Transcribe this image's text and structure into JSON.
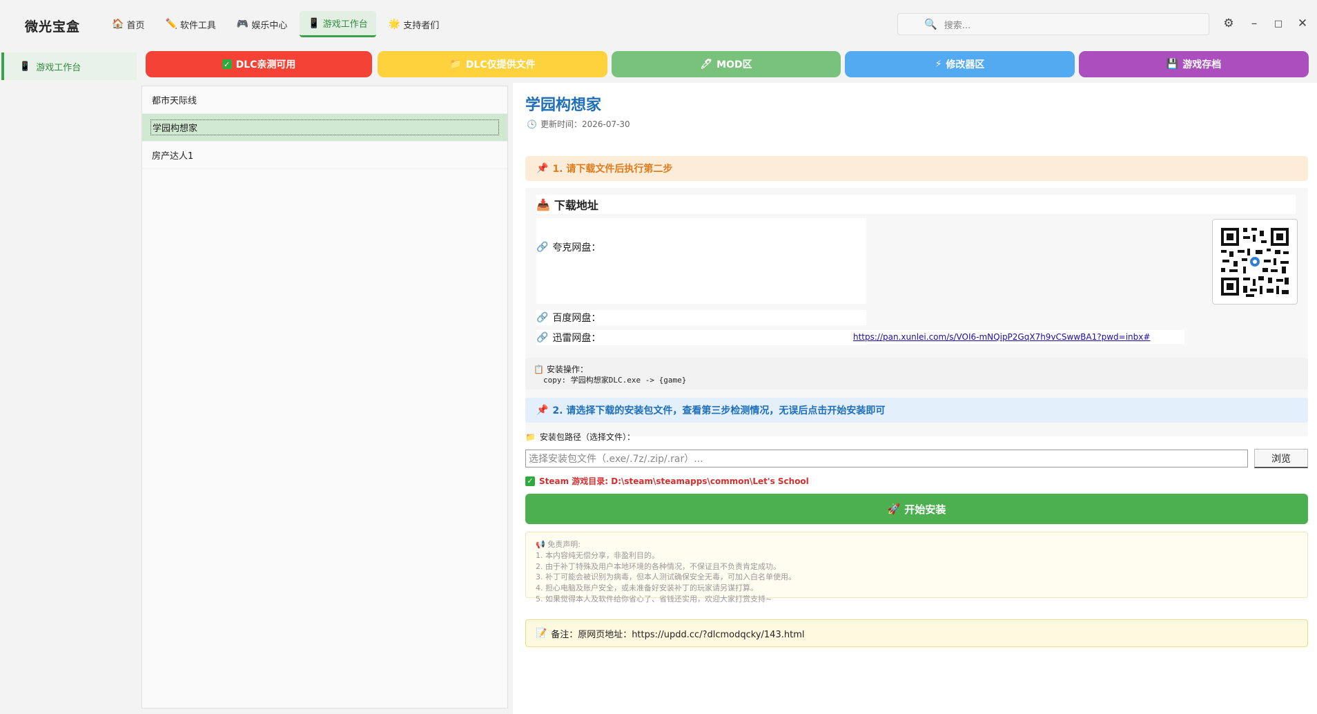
{
  "app": {
    "title": "微光宝盒"
  },
  "nav": {
    "items": [
      {
        "label": "首页",
        "icon": "home-icon"
      },
      {
        "label": "软件工具",
        "icon": "pencil-icon"
      },
      {
        "label": "娱乐中心",
        "icon": "gamepad-icon"
      },
      {
        "label": "游戏工作台",
        "icon": "phone-icon"
      },
      {
        "label": "支持者们",
        "icon": "star-icon"
      }
    ],
    "active": "游戏工作台"
  },
  "search": {
    "placeholder": "搜索..."
  },
  "sidebar": {
    "items": [
      {
        "label": "游戏工作台"
      }
    ]
  },
  "categories": [
    {
      "label": "DLC亲测可用",
      "icon": "check-icon",
      "color": "#f44336"
    },
    {
      "label": "DLC仅提供文件",
      "icon": "folder-icon",
      "color": "#fdd23d"
    },
    {
      "label": "MOD区",
      "icon": "pen-icon",
      "color": "#78c27c"
    },
    {
      "label": "修改器区",
      "icon": "lightning-icon",
      "color": "#54aaf0"
    },
    {
      "label": "游戏存档",
      "icon": "save-icon",
      "color": "#ab4fbf"
    }
  ],
  "game_list": [
    {
      "name": "都市天际线",
      "selected": false
    },
    {
      "name": "学园构想家",
      "selected": true
    },
    {
      "name": "房产达人1",
      "selected": false
    }
  ],
  "detail": {
    "title": "学园构想家",
    "update_time": "更新时间：2026-07-30",
    "step1": "1. 请下载文件后执行第二步",
    "download_header": "下载地址",
    "quark_label": "夸克网盘：",
    "baidu_label": "百度网盘：",
    "xunlei_label": "迅雷网盘：",
    "xunlei_link": "https://pan.xunlei.com/s/VOI6-mNQipP2GqX7h9vCSwwBA1?pwd=inbx#",
    "install_label": "安装操作：",
    "install_cmd": "copy: 学园构想家DLC.exe -> {game}",
    "step2": "2. 请选择下载的安装包文件，查看第三步检测情况，无误后点击开始安装即可",
    "path_label": "安装包路径（选择文件）：",
    "path_placeholder": "选择安装包文件（.exe/.7z/.zip/.rar）...",
    "browse_label": "浏览",
    "steam_dir": "Steam 游戏目录: D:\\steam\\steamapps\\common\\Let's School",
    "start_label": "开始安装",
    "disclaimer_title": "免责声明:",
    "disclaimer_lines": [
      "1. 本内容纯无偿分享，非盈利目的。",
      "2. 由于补丁特殊及用户本地环境的各种情况，不保证且不负责肯定成功。",
      "3. 补丁可能会被识别为病毒，但本人测试确保安全无毒，可加入白名单使用。",
      "4. 担心电脑及账户安全，或未准备好安装补丁的玩家请另谋打算。",
      "5. 如果觉得本人及软件给你省心了、省钱还实用，欢迎大家打赏支持~"
    ],
    "note": "备注：原网页地址：https://updd.cc/?dlcmodqcky/143.html"
  }
}
